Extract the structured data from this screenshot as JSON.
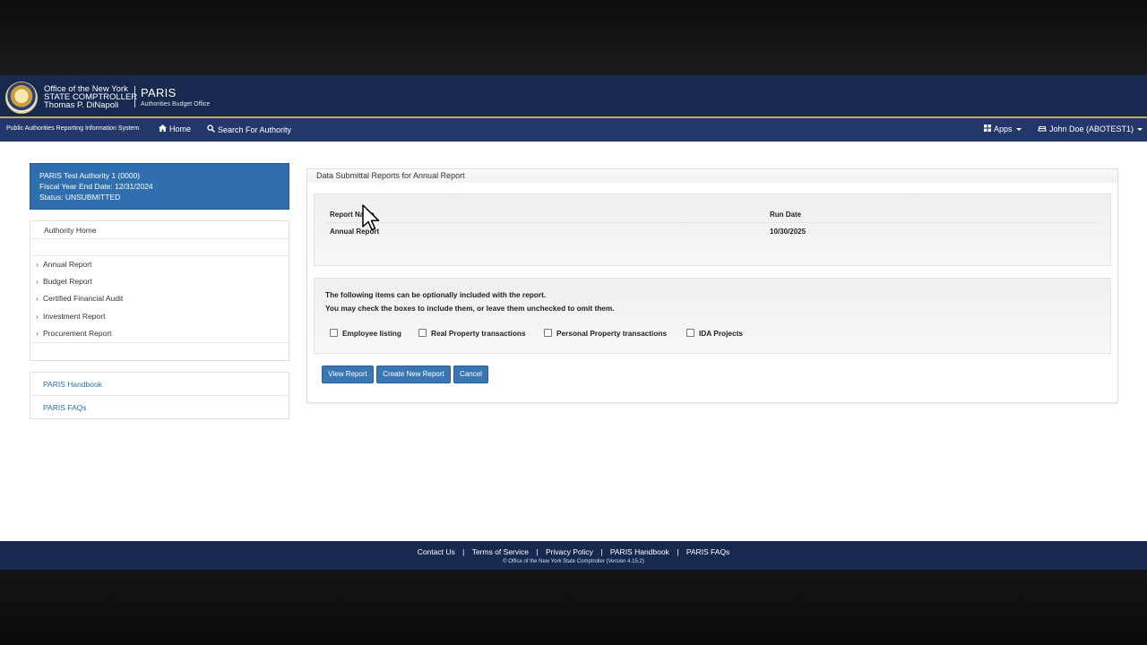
{
  "colors": {
    "header_navy": "#17294f",
    "navbar_blue": "#23386a",
    "accent_gold": "#c9a94b",
    "authority_panel": "#2f6fae",
    "button_blue": "#3a76b3",
    "link_blue": "#2e6da4"
  },
  "header": {
    "office_line1": "Office of the New York",
    "office_line2": "STATE COMPTROLLER",
    "office_line3": "Thomas P. DiNapoli",
    "app_title": "PARIS",
    "app_subtitle": "Authorities Budget Office",
    "seal_icon": "nys-seal-icon"
  },
  "navbar": {
    "brand": "Public Authorities Reporting Information System",
    "home_label": "Home",
    "home_icon": "home-icon",
    "search_label": "Search For Authority",
    "search_icon": "search-icon",
    "apps_label": "Apps",
    "apps_icon": "grid-icon",
    "user_label": "John Doe (ABOTEST1)",
    "user_icon": "user-icon"
  },
  "authority": {
    "name": "PARIS Test Authority 1 (0000)",
    "fiscal_year": "Fiscal Year End Date: 12/31/2024",
    "status": "Status: UNSUBMITTED"
  },
  "sidebar": {
    "home": "Authority Home",
    "items": [
      {
        "label": "Annual Report"
      },
      {
        "label": "Budget Report"
      },
      {
        "label": "Certified Financial Audit"
      },
      {
        "label": "Investment Report"
      },
      {
        "label": "Procurement Report"
      }
    ],
    "links": [
      {
        "label": "PARIS Handbook"
      },
      {
        "label": "PARIS FAQs"
      }
    ]
  },
  "main": {
    "panel_title": "Data Submittal Reports for Annual Report",
    "table": {
      "headers": [
        "Report Name",
        "Run Date"
      ],
      "rows": [
        [
          "Annual Report",
          "10/30/2025"
        ]
      ]
    },
    "options_line1": "The following items can be optionally included with the report.",
    "options_line2": "You may check the boxes to include them, or leave them unchecked to omit them.",
    "options": [
      {
        "label": "Employee listing",
        "checked": false
      },
      {
        "label": "Real Property transactions",
        "checked": false
      },
      {
        "label": "Personal Property transactions",
        "checked": false
      },
      {
        "label": "IDA Projects",
        "checked": false
      }
    ],
    "buttons": {
      "view": "View Report",
      "create": "Create New Report",
      "cancel": "Cancel"
    }
  },
  "footer": {
    "links": [
      "Contact Us",
      "Terms of Service",
      "Privacy Policy",
      "PARIS Handbook",
      "PARIS FAQs"
    ],
    "separator": "|",
    "copyright": "© Office of the New York State Comptroller (Version 4.15.2)"
  }
}
